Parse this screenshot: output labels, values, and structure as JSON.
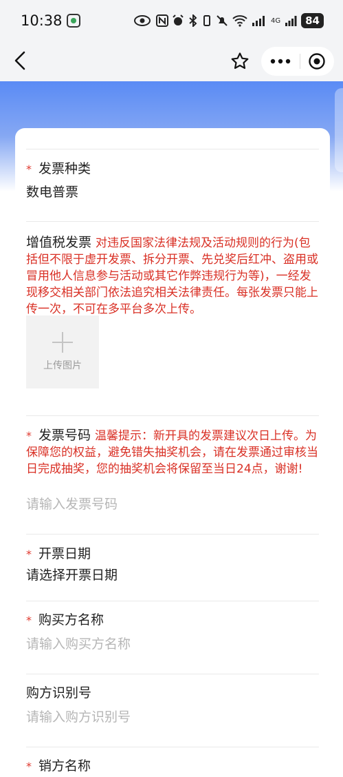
{
  "status_bar": {
    "time": "10:38",
    "battery": "84",
    "network": "4G"
  },
  "nav": {
    "icons": [
      "back-icon",
      "star-icon",
      "more-icon",
      "target-icon"
    ]
  },
  "form": {
    "invoice_type": {
      "label": "发票种类",
      "value": "数电普票"
    },
    "vat_invoice": {
      "label": "增值税发票",
      "notice": "对违反国家法律法规及活动规则的行为(包括但不限于虚开发票、拆分开票、先兑奖后红冲、盗用或冒用他人信息参与活动或其它作弊违规行为等)，一经发现移交相关部门依法追究相关法律责任。每张发票只能上传一次，不可在多平台多次上传。",
      "upload_label": "上传图片"
    },
    "invoice_number": {
      "label": "发票号码",
      "hint": "温馨提示：新开具的发票建议次日上传。为保障您的权益，避免错失抽奖机会，请在发票通过审核当日完成抽奖，您的抽奖机会将保留至当日24点，谢谢!",
      "placeholder": "请输入发票号码"
    },
    "invoice_date": {
      "label": "开票日期",
      "value": "请选择开票日期"
    },
    "buyer_name": {
      "label": "购买方名称",
      "placeholder": "请输入购买方名称"
    },
    "buyer_id": {
      "label": "购方识别号",
      "placeholder": "请输入购方识别号"
    },
    "seller_name": {
      "label": "销方名称"
    },
    "required_mark": "*"
  }
}
